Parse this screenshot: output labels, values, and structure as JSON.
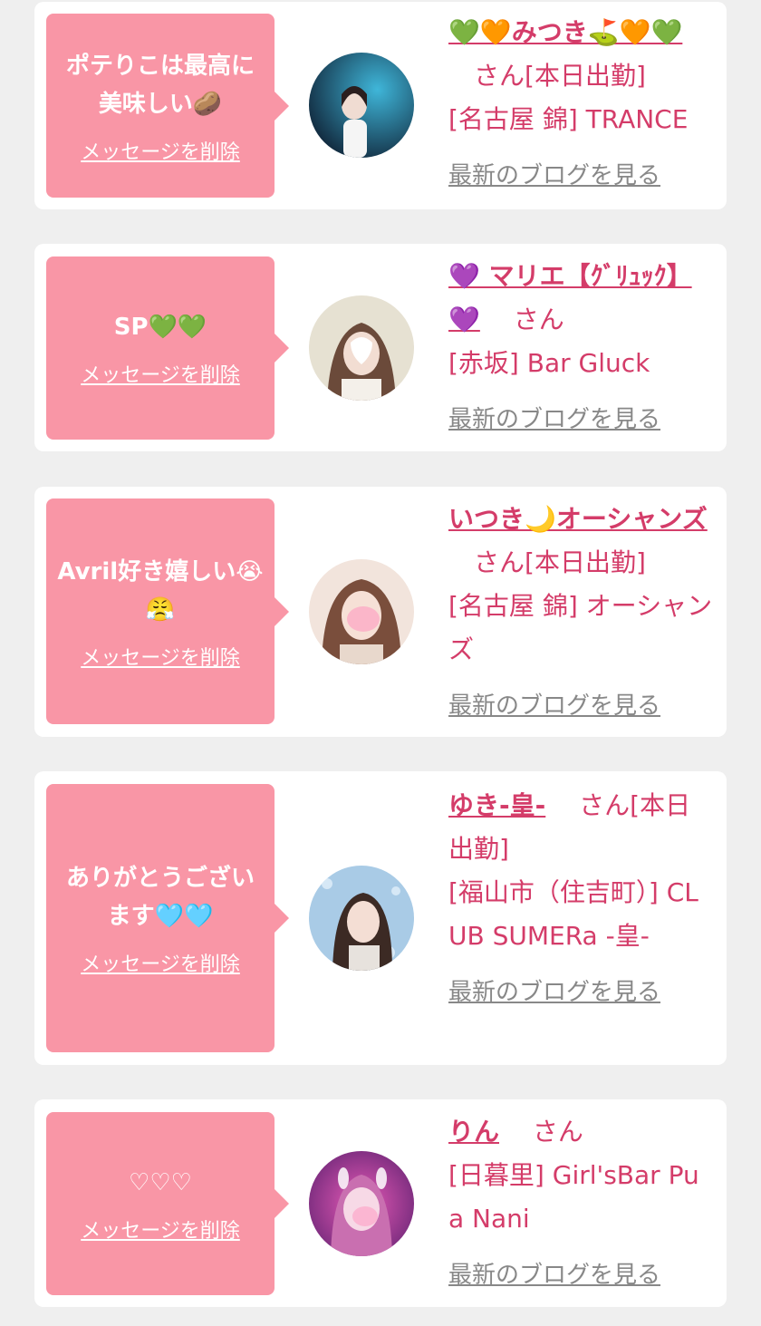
{
  "cards": [
    {
      "message": "ポテりこは最高に美味しい🥔",
      "delete_label": "メッセージを削除",
      "name": "💚🧡みつき⛳🧡💚",
      "san": "さん",
      "status": "[本日出勤]",
      "shop": "[名古屋 錦] TRANCE",
      "blog_label": "最新のブログを見る",
      "avatar_colors": [
        "#0d1b2e",
        "#3fb6d9"
      ]
    },
    {
      "message": "SP💚💚",
      "delete_label": "メッセージを削除",
      "name": "💜 マリエ【ｸﾞﾘｭｯｸ】💜",
      "san": "さん",
      "status": "",
      "shop": "[赤坂] Bar Gluck",
      "blog_label": "最新のブログを見る",
      "avatar_colors": [
        "#d8d4c0",
        "#e9e5dc"
      ]
    },
    {
      "message": "Avril好き嬉しい😭😤",
      "delete_label": "メッセージを削除",
      "name": "いつき🌙オーシャンズ",
      "san": "さん",
      "status": "[本日出勤]",
      "shop": "[名古屋 錦] オーシャンズ",
      "blog_label": "最新のブログを見る",
      "avatar_colors": [
        "#f4e2da",
        "#e9c7b8"
      ]
    },
    {
      "message": "ありがとうございます🩵🩵",
      "delete_label": "メッセージを削除",
      "name": "ゆき-皇-",
      "san": "さん",
      "status": "[本日出勤]",
      "shop": "[福山市（住吉町）] CLUB SUMERa -皇-",
      "blog_label": "最新のブログを見る",
      "avatar_colors": [
        "#9fc3df",
        "#c9dff0"
      ]
    },
    {
      "message": "♡♡♡",
      "delete_label": "メッセージを削除",
      "name": "りん",
      "san": "さん",
      "status": "",
      "shop": "[日暮里] Girl'sBar Pua Nani",
      "blog_label": "最新のブログを見る",
      "avatar_colors": [
        "#5a1f6e",
        "#e85bb7"
      ]
    }
  ],
  "colors": {
    "bubble": "#f996a6",
    "accent": "#d43c69",
    "blog_link": "#888888",
    "background": "#efefef"
  }
}
